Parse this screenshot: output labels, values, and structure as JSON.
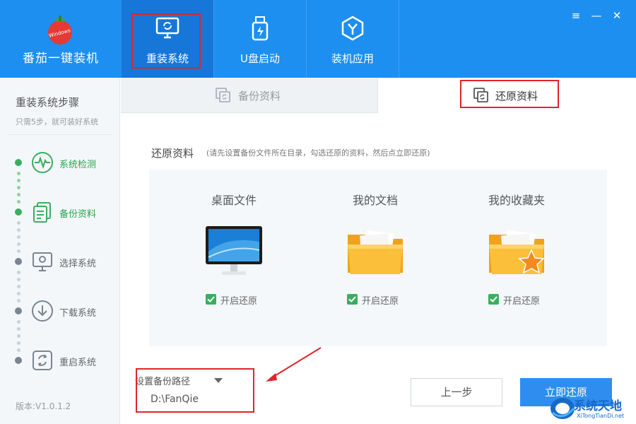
{
  "brand": {
    "name": "番茄一键装机",
    "logo_text": "Windows"
  },
  "nav": {
    "tabs": [
      {
        "label": "重装系统",
        "icon": "monitor-refresh-icon"
      },
      {
        "label": "U盘启动",
        "icon": "usb-drive-icon"
      },
      {
        "label": "装机应用",
        "icon": "apps-shield-icon"
      }
    ],
    "active_index": 0
  },
  "window": {
    "menu": "≡",
    "minimize": "—",
    "close": "✕"
  },
  "sidebar": {
    "title": "重装系统步骤",
    "subtitle": "只需5步，就可装好系统",
    "steps": [
      {
        "label": "系统检测",
        "icon": "pulse-icon",
        "done": true
      },
      {
        "label": "备份资料",
        "icon": "documents-icon",
        "done": true
      },
      {
        "label": "选择系统",
        "icon": "monitor-icon",
        "done": false
      },
      {
        "label": "下载系统",
        "icon": "download-icon",
        "done": false
      },
      {
        "label": "重启系统",
        "icon": "restart-icon",
        "done": false
      }
    ],
    "version": "版本:V1.0.1.2"
  },
  "subtabs": {
    "backup": "备份资料",
    "restore": "还原资料"
  },
  "section": {
    "title": "还原资料",
    "hint": "(请先设置备份文件所在目录，勾选还原的资料，然后点立即还原)"
  },
  "cards": [
    {
      "title": "桌面文件",
      "check_label": "开启还原",
      "checked": true,
      "icon": "desktop-monitor-icon"
    },
    {
      "title": "我的文档",
      "check_label": "开启还原",
      "checked": true,
      "icon": "folder-icon"
    },
    {
      "title": "我的收藏夹",
      "check_label": "开启还原",
      "checked": true,
      "icon": "folder-star-icon"
    }
  ],
  "backup_path": {
    "label": "设置备份路径",
    "value": "D:\\FanQie"
  },
  "buttons": {
    "prev": "上一步",
    "restore": "立即还原"
  },
  "watermark": {
    "text": "系统天地",
    "sub": "XiTongTianDi.net"
  },
  "colors": {
    "header": "#1d8ff0",
    "active_tab": "#1677d8",
    "accent_green": "#27a64a",
    "primary_button": "#2f8df0",
    "annotation_red": "#e0242a"
  }
}
